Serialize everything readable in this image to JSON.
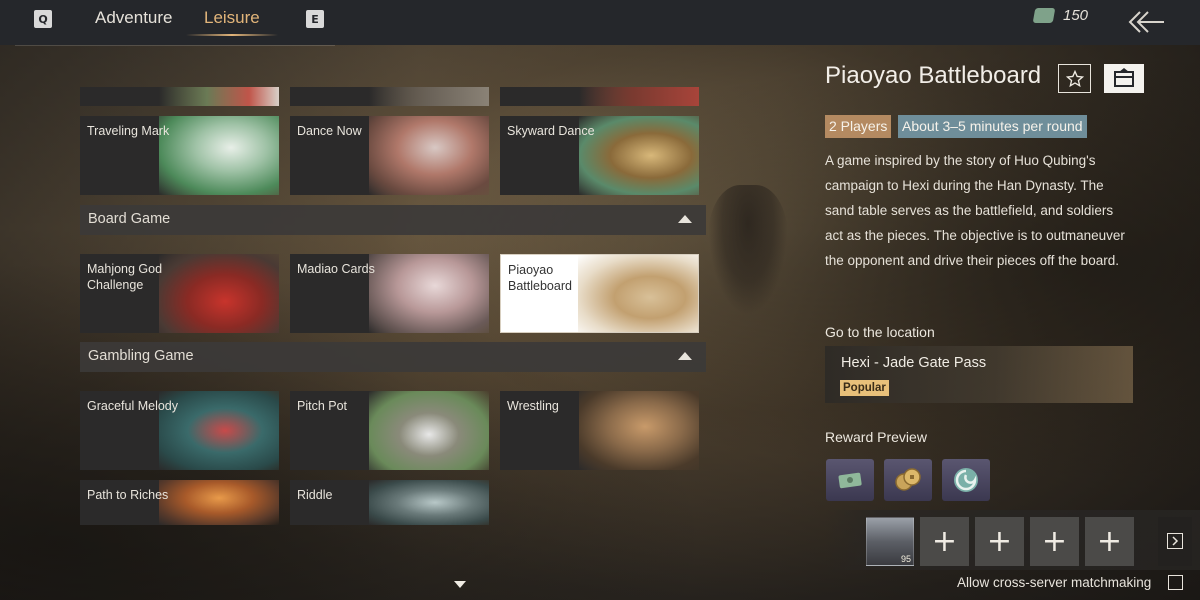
{
  "topbar": {
    "key_left": "Q",
    "key_right": "E",
    "tabs": [
      {
        "label": "Adventure",
        "active": false
      },
      {
        "label": "Leisure",
        "active": true
      }
    ],
    "currency_icon": "banknote-icon",
    "currency_value": "150",
    "back_icon": "back-arrow-icon"
  },
  "games": {
    "row_top_partial": [
      "",
      "",
      ""
    ],
    "row1": [
      {
        "label": "Traveling Mark"
      },
      {
        "label": "Dance Now"
      },
      {
        "label": "Skyward Dance"
      }
    ],
    "sections": [
      {
        "title": "Board Game",
        "items": [
          {
            "label": "Mahjong God Challenge"
          },
          {
            "label": "Madiao Cards"
          },
          {
            "label": "Piaoyao Battleboard",
            "selected": true
          }
        ]
      },
      {
        "title": "Gambling Game",
        "items": [
          {
            "label": "Graceful Melody"
          },
          {
            "label": "Pitch Pot"
          },
          {
            "label": "Wrestling"
          },
          {
            "label": "Path to Riches"
          },
          {
            "label": "Riddle"
          }
        ]
      }
    ]
  },
  "detail": {
    "title": "Piaoyao Battleboard",
    "tag_players": "2 Players",
    "tag_time": "About 3–5 minutes per round",
    "description": "A game inspired by the story of Huo Qubing's campaign to Hexi during the Han Dynasty. The sand table serves as the battlefield, and soldiers act as the pieces. The objective is to outmaneuver the opponent and drive their pieces off the board.",
    "location_heading": "Go to the location",
    "location_name": "Hexi - Jade Gate Pass",
    "location_badge": "Popular",
    "reward_heading": "Reward Preview",
    "rewards": [
      "banknote-icon",
      "coins-icon",
      "swirl-token-icon"
    ]
  },
  "team": {
    "avatar_level": "95",
    "empty_slot_symbol": "+",
    "cross_server_label": "Allow cross-server matchmaking",
    "cross_server_checked": false
  },
  "colors": {
    "accent_tab": "#e2b57a",
    "tag_players_bg": "#b48a61",
    "tag_time_bg": "#6f8e9a",
    "popular_badge_bg": "#e8c07a"
  }
}
